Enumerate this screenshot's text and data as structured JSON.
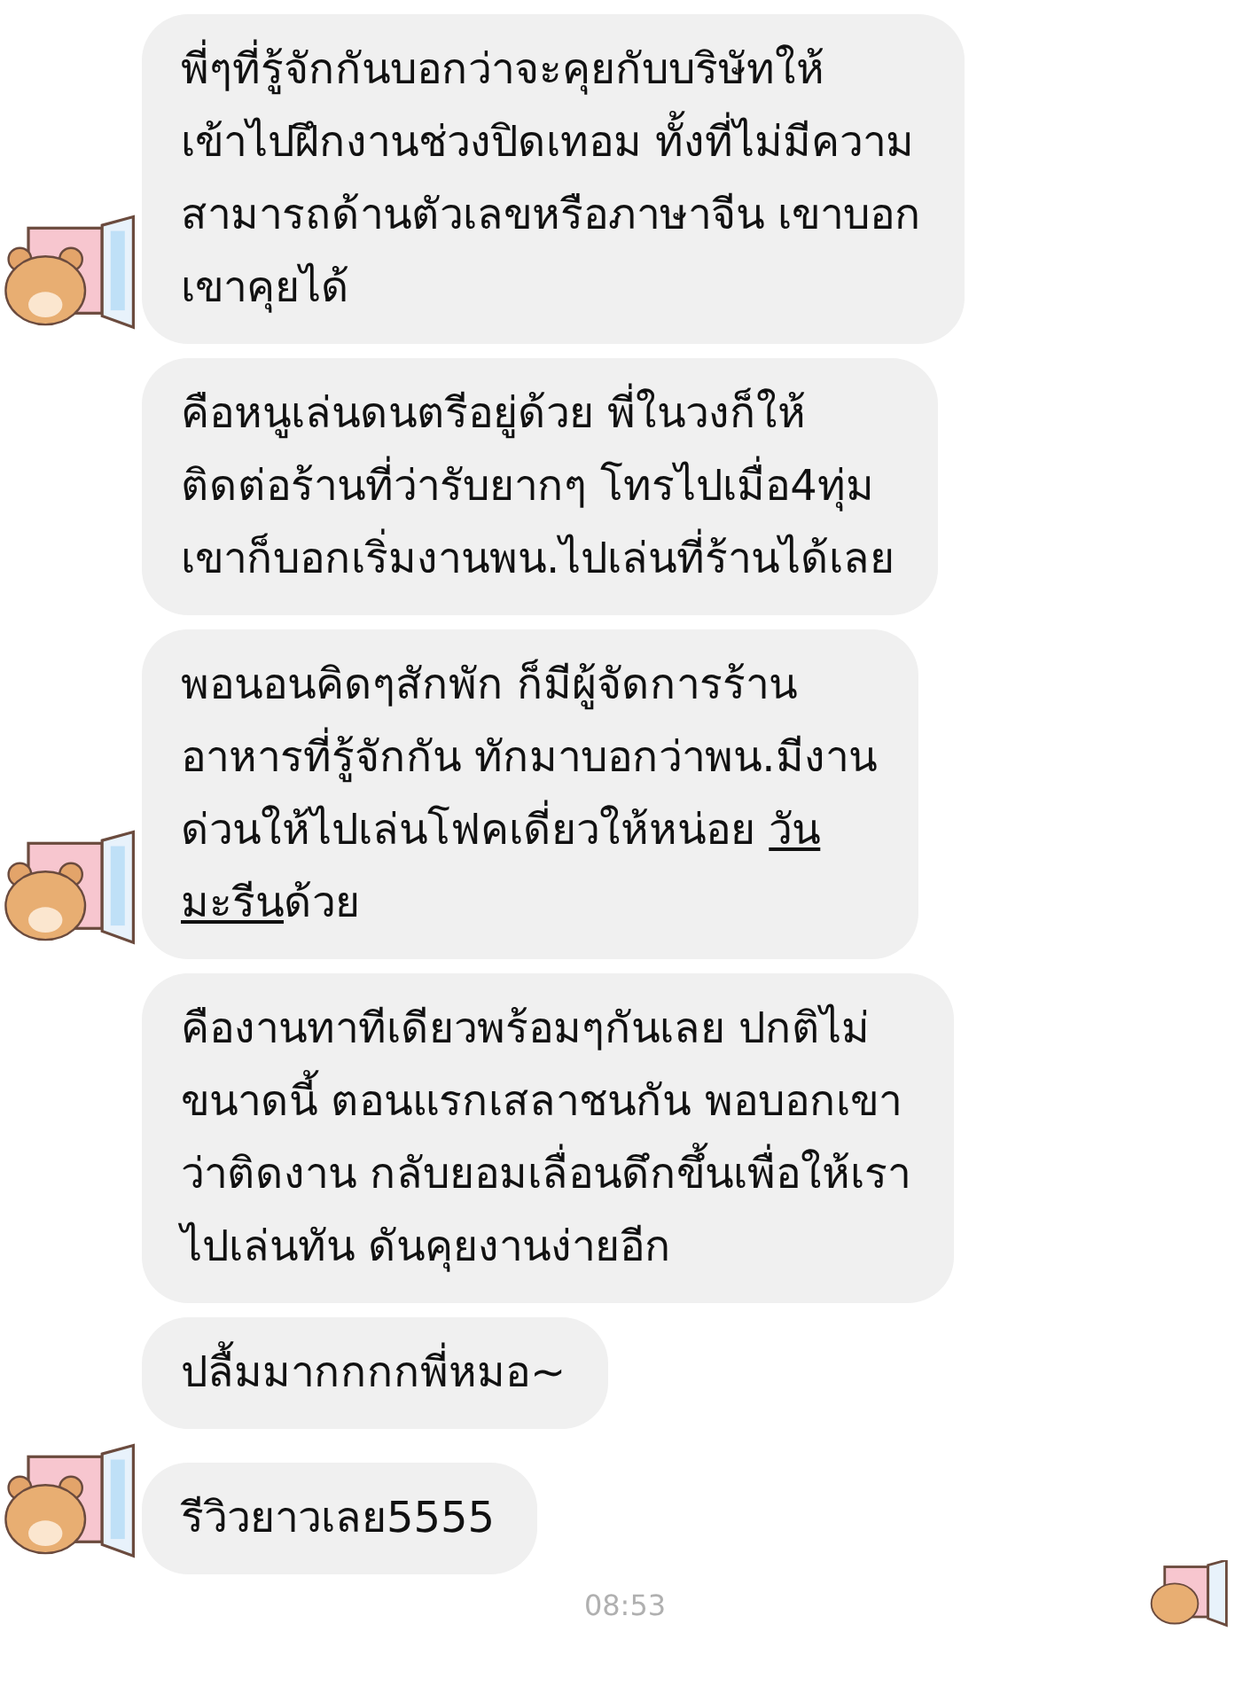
{
  "messages": [
    {
      "avatar": true,
      "segments": [
        {
          "text": "พี่ๆที่รู้จักกันบอกว่าจะคุยกับบริษัทให้\nเข้าไปฝึกงานช่วงปิดเทอม ทั้งที่ไม่มีความ\nสามารถด้านตัวเลขหรือภาษาจีน เขาบอก\nเขาคุยได้",
          "underlined": false
        }
      ]
    },
    {
      "avatar": false,
      "segments": [
        {
          "text": "คือหนูเล่นดนตรีอยู่ด้วย พี่ในวงก็ให้\nติดต่อร้านที่ว่ารับยากๆ โทรไปเมื่อ4ทุ่ม\nเขาก็บอกเริ่มงานพน.ไปเล่นที่ร้านได้เลย",
          "underlined": false
        }
      ]
    },
    {
      "avatar": true,
      "segments": [
        {
          "text": "พอนอนคิดๆสักพัก ก็มีผู้จัดการร้าน\nอาหารที่รู้จักกัน ทักมาบอกว่าพน.มีงาน\nด่วนให้ไปเล่นโฟคเดี่ยวให้หน่อย ",
          "underlined": false
        },
        {
          "text": "วัน\nมะรีน",
          "underlined": true
        },
        {
          "text": "ด้วย",
          "underlined": false
        }
      ]
    },
    {
      "avatar": false,
      "segments": [
        {
          "text": "คืองานทาทีเดียวพร้อมๆกันเลย ปกติไม่\nขนาดนี้ ตอนแรกเสลาชนกัน พอบอกเขา\nว่าติดงาน กลับยอมเลื่อนดึกขึ้นเพื่อให้เรา\nไปเล่นทัน ดันคุยงานง่ายอีก",
          "underlined": false
        }
      ]
    },
    {
      "avatar": false,
      "segments": [
        {
          "text": "ปลื้มมากกกกพี่หมอ~",
          "underlined": false
        }
      ]
    },
    {
      "avatar": true,
      "segments": [
        {
          "text": "รีวิวยาวเลย5555",
          "underlined": false
        }
      ]
    }
  ],
  "timestamp": "08:53"
}
